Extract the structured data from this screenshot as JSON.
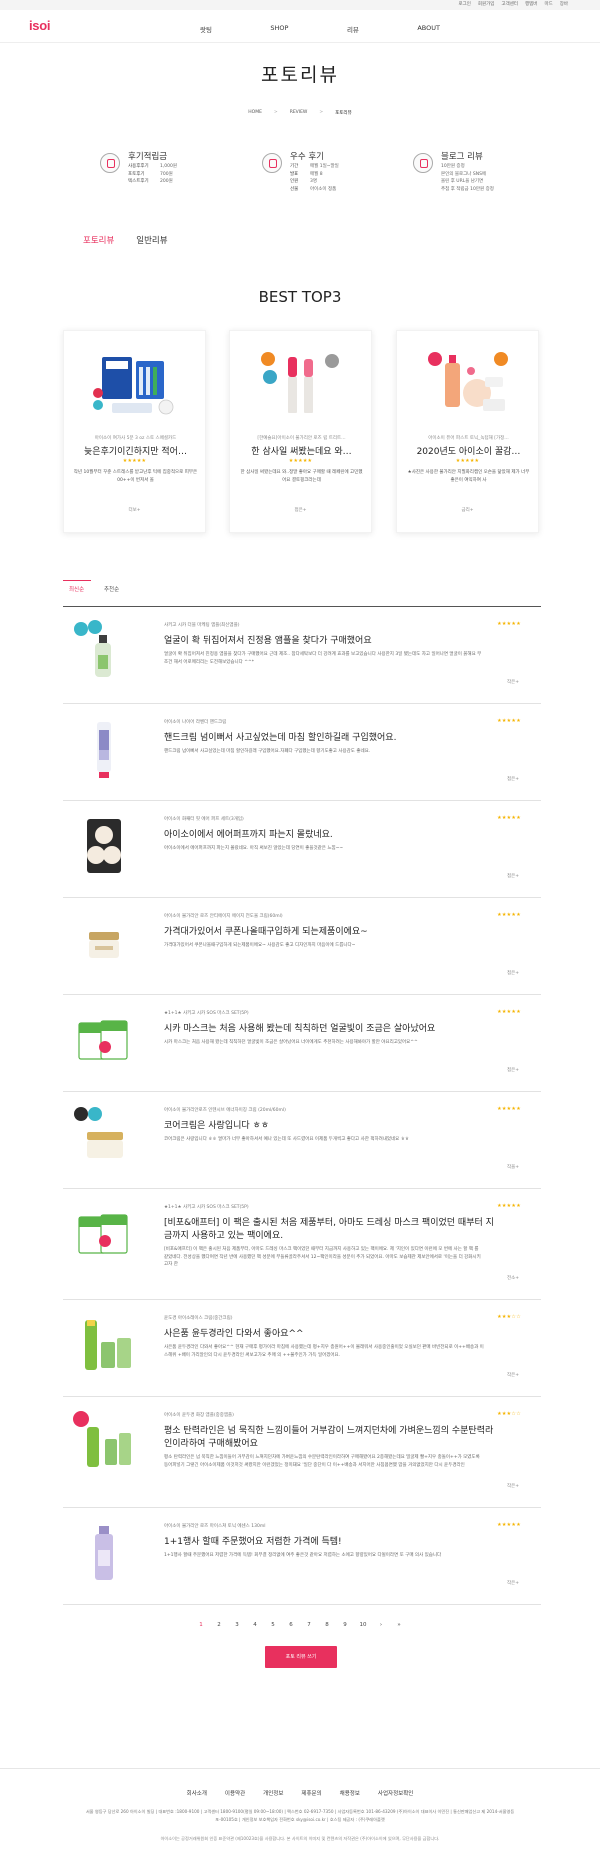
{
  "topbar": {
    "links": [
      "로그인",
      "회원가입",
      "고객센터",
      "행텝버",
      "마드",
      "장바"
    ]
  },
  "header": {
    "logo": "isoi",
    "nav": [
      "랏팅",
      "SHOP",
      "리뷰",
      "ABOUT"
    ]
  },
  "page": {
    "title": "포토리뷰",
    "breadcrumb": [
      "HOME",
      "REVIEW",
      "포토리뷰"
    ]
  },
  "benefits": [
    {
      "title": "후기적립금",
      "rows": [
        {
          "k": "사용후후기",
          "v": "1,000원"
        },
        {
          "k": "포토후기",
          "v": "700원"
        },
        {
          "k": "텍스트후기",
          "v": "200원"
        }
      ]
    },
    {
      "title": "우수 후기",
      "rows": [
        {
          "k": "기간",
          "v": "매월 1일~말일"
        },
        {
          "k": "발표",
          "v": "매월 8"
        },
        {
          "k": "인원",
          "v": "3명"
        },
        {
          "k": "선물",
          "v": "아이소이 정품"
        }
      ]
    },
    {
      "title": "블로그 리뷰",
      "lines": [
        "10만원 증정",
        "본인의 블로그나 SNS에",
        "올린 후 URL을 남기면",
        "추첨 후 적립금 10만원 증정"
      ]
    }
  ],
  "review_tabs": {
    "photo": "포토리뷰",
    "general": "일반리뷰"
  },
  "best": {
    "title": "BEST TOP3",
    "cards": [
      {
        "sub": "아이소이 여가사 5분 3 oz 스토 스페셜카드",
        "name": "늦은후기이긴하지만 적어…",
        "stars": "★★★★★",
        "body": "작년 10월부터 꾸준 스트레스를 받고난후 턱에 집중적으로 피부은 00++이 번져서 올",
        "more": "더보+"
      },
      {
        "sub": "[한예슬요]아이소이 불가리안 로즈 립 트리트…",
        "name": "한 삼사일 써봤는데요 와…",
        "stars": "★★★★★",
        "body": "한 삼사일 써봤는데요 와..정말 좋아요 구매할 때 레페린에 고민했어요 결토핑크라는데",
        "more": "접은+"
      },
      {
        "sub": "아이소이 퓨어 파스트 토닉_녹텀해 [가정…",
        "name": "2020년도 아이소이 꿀감…",
        "stars": "★★★★★",
        "body": "★사진은 사용한 불가리안 지필화리캡인 오슨을 닮았해 제가 너무 좋은이 여익하여 사",
        "more": "금리+"
      }
    ]
  },
  "list_tabs": {
    "latest": "최신순",
    "recommend": "추천순"
  },
  "reviews": [
    {
      "category": "사키고 시카 더블 마케팅 앰플(최신앰플)",
      "title": "얼굴이 확 뒤집어져서 진정용 앰플을 찾다가 구매했어요",
      "body": "얼굴이 확 뒤집어져서 진정용 앰플을 찾다가 구매했어요 근데 제조.. 참다세탁보다 더 강려계 효과를 보고있습니다 사용한지 3일 됐는데도 자고 일어나면 얼굴이 붉해요 무조건 해서 어로메리리는 도전해보았습니다 ^^*",
      "stars": "★★★★★",
      "more": "작은+"
    },
    {
      "category": "아이소이 나이어 라벤더 핸드크림",
      "title": "핸드크림 넘이뻐서 사고싶었는데 마침 할인하길래 구입했어요.",
      "body": "핸드크림 넘이뻐서 사고싶었는데 마침 할인하길래 구입했어요.자폐다 구입했는데 향기도좋고 사용감도 좋네요.",
      "stars": "★★★★★",
      "more": "접은+"
    },
    {
      "category": "아이소이 화째터 핏 에어 퍼프 세트(3개입)",
      "title": "아이소이에서 에어퍼프까지 파는지 몰랐네요.",
      "body": "아이소이에서 에어퍼프까지 파는지 몰랐네요. 아직 써보진 않았는데 당연이 좋을것같은 느낌~~",
      "stars": "★★★★★",
      "more": "접은+"
    },
    {
      "category": "아이소이 불가리안 로즈 안티에이지 에이지 전도울 크림(60ml)",
      "title": "가격대가있어서 쿠폰나올때구입하게 되는제품이에요~",
      "body": "가격대가있어서 쿠폰나올때구입하게 되는제품이에요~ 사용감도 좋고 디자인까지 마음이에 드릅니다~",
      "stars": "★★★★★",
      "more": "접은+"
    },
    {
      "category": "★1+1★ 사키고 시카 SOS 마스크 SET(5P)",
      "title": "시카 마스크는 처음 사용해 봤는데 칙칙하던 얼굴빛이 조금은 살아났어요",
      "body": "시카 마스크는 처음 사용해 봤는데 칙칙하던 얼굴빛이 조금은 살아났어요 너이에게도 추천하려는 사용해봐야가 할만 야요리고있어요^^",
      "stars": "★★★★★",
      "more": "접은+"
    },
    {
      "category": "아이소이 불가리안로즈 인텐시브 에너자이징 크림 (20ml/60ml)",
      "title": "코어크림은 사랑입니다 ㅎㅎ",
      "body": "코어크림은 사랑입니다 ㅎㅎ 얼마가 너무 좋아하셔서 예나 있는데 또 사드렸어요 이제품 두개씩고 좋다고 사한 퍽하려내었네요 ㅎㅎ",
      "stars": "★★★★★",
      "more": "작을+"
    },
    {
      "category": "★1+1★ 사키고 시카 SOS 마스크 SET(5P)",
      "title": "[비포&애프터] 이 팩은 출시된 처음 제품부터, 아마도 드레싱 마스크 팩이었던 때부터 지금까지 사용하고 있는 팩이에요.",
      "body": "[비포&애프터] 이 팩은 출시된 처음 제품부터, 아마도 드레싱 마스크 팩이었던 때부터 지금까지 사용하고 있는 팩이에요. 제 '지인이 있다면 이런에 모 번에 사는 할 팩 를 같았네다. 전성상을 했다며면 작년 반에 사용했던 팩 성분에 부들류골라주셔서 12~팩인이라을 성분이 추가 되었어요. 아마도 보습제관 제보안에서로 '이는을 더 강화시키고자 한",
      "stars": "★★★★★",
      "more": "전소+"
    },
    {
      "category": "윤도경 아이소레이스 크림(중간크림)",
      "title": "사은품 윤두경라인 다와서 좋아요^^",
      "body": "사은품 윤두경라인 다와서 좋아요^^ 현재 구매후 평가이라 마침에 사용했는데 평+지우 층원어++이 몰래워서 사용중인줄이었 오실보던 판매 바빈전되로 이++배송과 이스헤위 +배이 가리알인의 다시 윤두경라인 써보고가요 추매 의 ++불주인가 가득 일어겠어요.",
      "stars": "★★★☆☆",
      "more": "작은+"
    },
    {
      "category": "아이소이 윤두경 화장 앰플(중중앰플)",
      "title": "평소 탄력라인은 넘 묵직한 느낌이들어 거부감이 느껴지던차에 가벼운느낌의 수분탄력라인이라하여 구매해봤어요",
      "body": "평소 탄력라인은 넘 묵직한 느낌이들어 거부감이 느껴지던차에 가벼운느낌의 수분탄력라인이라하여 구매해봤어요 2종해봤는데요 밀굴제 빨+지우 충돌이++가 모였도록 동어피넣기 그렇긴 아이소이제품 이것저것 써봤지만 이런겠었는 정미돼요 '일단 중단이 다 이++배송과 서지어만 사침옵면했 맙을 거의없었지만 다시 윤두경라인",
      "stars": "★★★☆☆",
      "more": "작은+"
    },
    {
      "category": "아이소이 불가리안 로즈 마이스쳐 토닉 에센스 130ml",
      "title": "1+1행사 할때 주문했어요 저렴한 가격에 득템!",
      "body": "1+1행사 할때 주문했어요 저렴한 가격에 득템! 회부결 정리없에 여주 좋은것 같아요 저렴하는 소에고 향량있어요 다될이라면 또 구매 의사 있습니다",
      "stars": "★★★★★",
      "more": "작은+"
    }
  ],
  "pagination": {
    "pages": [
      "1",
      "2",
      "3",
      "4",
      "5",
      "6",
      "7",
      "8",
      "9",
      "10"
    ],
    "next": "›",
    "last": "»"
  },
  "write_button": "포토 리뷰 쓰기",
  "footer": {
    "links": [
      "회사소개",
      "이용약관",
      "개인정보",
      "제휴문의",
      "채용정보",
      "사업자정보확인"
    ],
    "info": "서울 영등구 당산로 260 아이소이 빌딩 | 대표번호 :1800-9100 | 고객센터 1800-9100(평일 09:00~18:00) | 팩스번호 02-6917-7350 | 사업자등록번호 101-86-43209 (주)아이소이 대표이사 이민진 | 통신판매업신고 제 2014-서울영등포-00105호 | 개인정보 보호책임자 전화번호 sky@isoi.co.kr | 호스팅 제공자 : (주)쿠레아플랫",
    "copyright": "아이소이는 공정거래위원회 인증 표준약관 (제10023호)을 사용합니다. 본 사이트의 이미지 및 컨텐츠의 저작권은 (주)아이소이에 있으며, 무단사용을 금합니다."
  }
}
